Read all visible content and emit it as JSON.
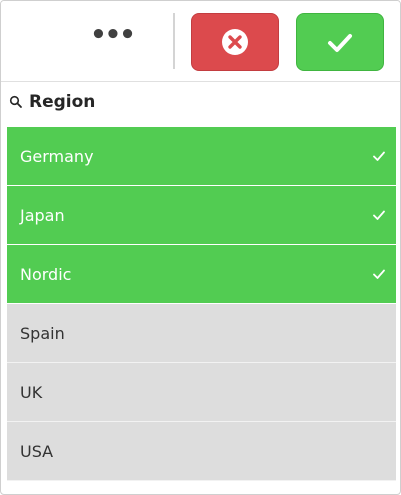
{
  "toolbar": {
    "more_label": "•••",
    "cancel_icon": "close-circle-icon",
    "confirm_icon": "check-icon",
    "colors": {
      "cancel": "#dc4a4d",
      "confirm": "#52cc52"
    }
  },
  "header": {
    "search_icon": "search-icon",
    "title": "Region"
  },
  "list": {
    "items": [
      {
        "label": "Germany",
        "state": "selected"
      },
      {
        "label": "Japan",
        "state": "selected"
      },
      {
        "label": "Nordic",
        "state": "selected"
      },
      {
        "label": "Spain",
        "state": "alternative"
      },
      {
        "label": "UK",
        "state": "alternative"
      },
      {
        "label": "USA",
        "state": "alternative"
      }
    ],
    "colors": {
      "selected": "#52cc52",
      "alternative": "#dddddd"
    }
  }
}
